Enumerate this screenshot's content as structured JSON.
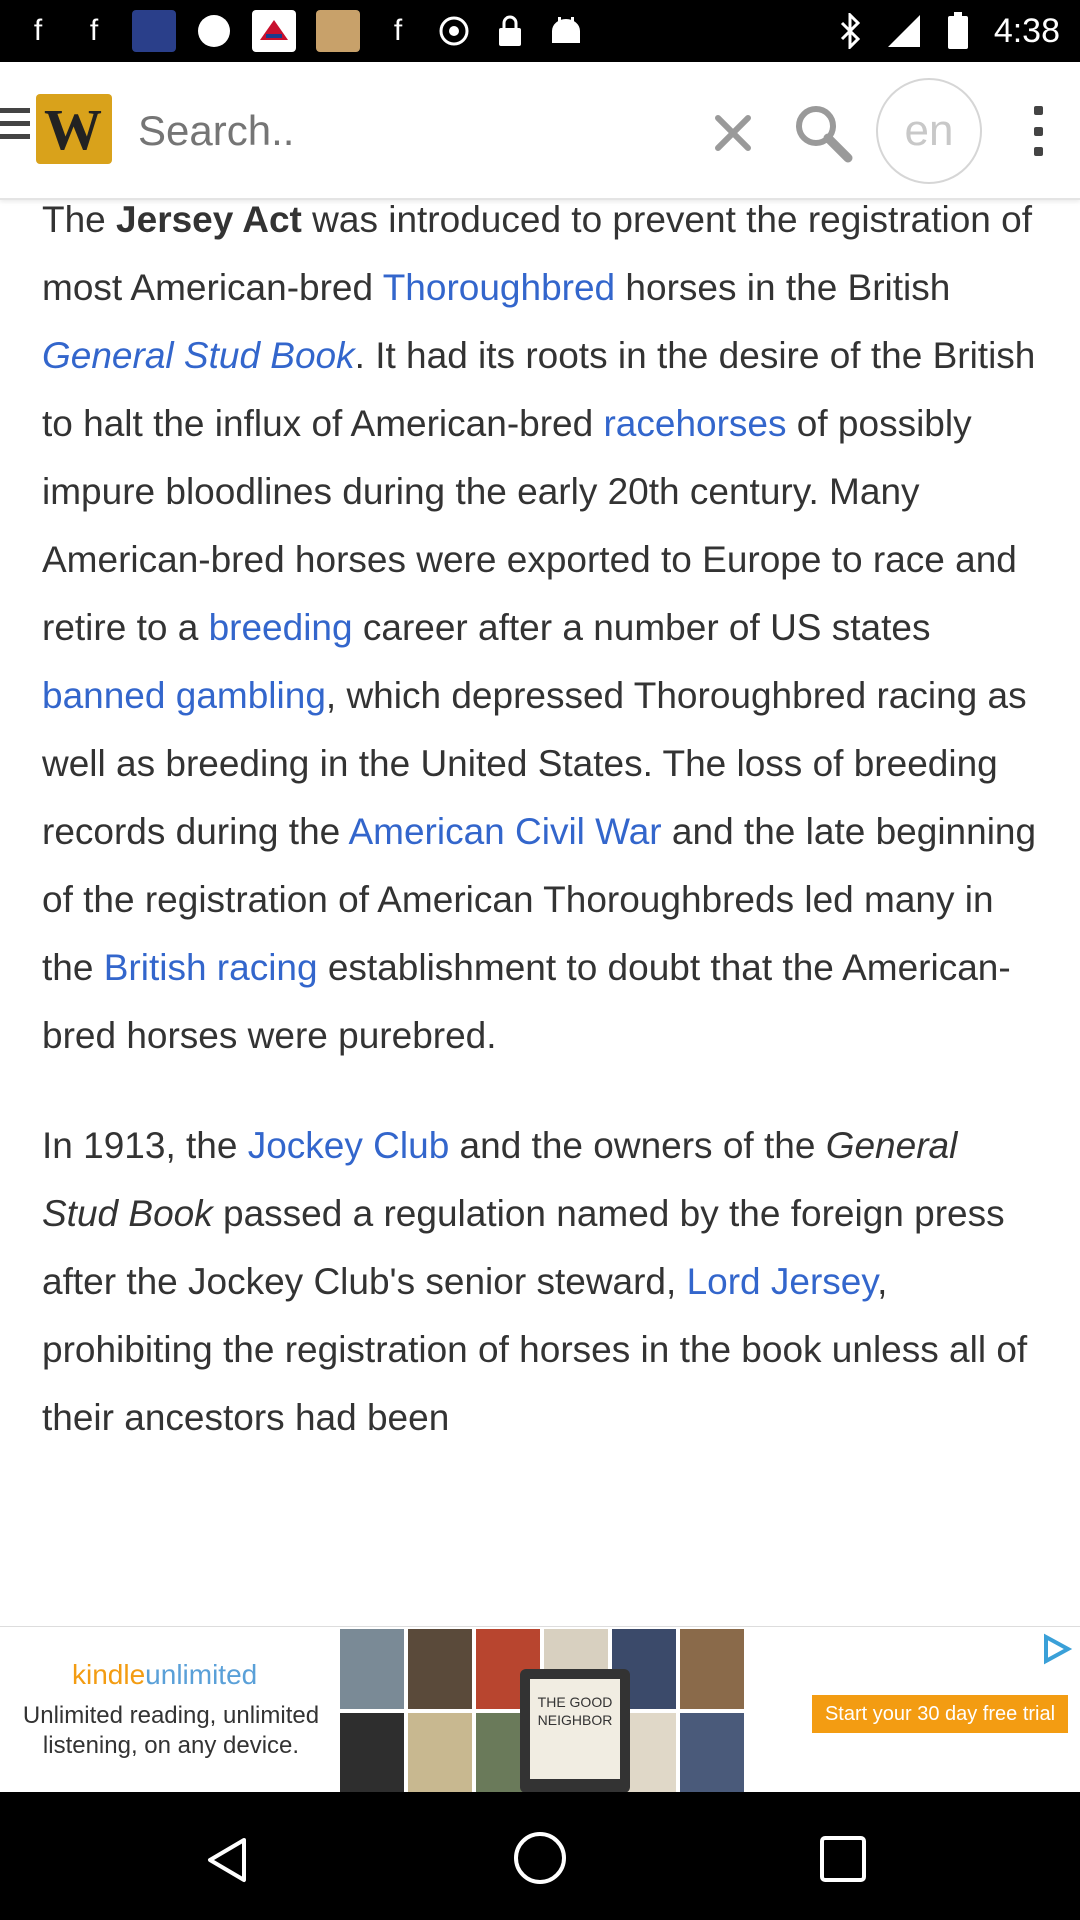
{
  "status_bar": {
    "time": "4:38",
    "icons": [
      "facebook-icon",
      "facebook-icon",
      "app-thumbnail",
      "circle-icon",
      "airline-icon",
      "app-thumbnail",
      "facebook-icon",
      "alarm-icon",
      "lock-icon",
      "android-icon",
      "bluetooth-icon",
      "signal-icon",
      "battery-icon"
    ]
  },
  "app_bar": {
    "logo_letter": "W",
    "search_placeholder": "Search..",
    "language": "en"
  },
  "article": {
    "p1": [
      {
        "t": "The "
      },
      {
        "t": "Jersey Act",
        "b": true
      },
      {
        "t": " was introduced to prevent the registration of most American-bred "
      },
      {
        "t": "Thoroughbred",
        "link": true
      },
      {
        "t": " horses in the British "
      },
      {
        "t": "General Stud Book",
        "link": true,
        "i": true
      },
      {
        "t": ". It had its roots in the desire of the British to halt the influx of American-bred "
      },
      {
        "t": "racehorses",
        "link": true
      },
      {
        "t": " of possibly impure bloodlines during the early 20th century. Many American-bred horses were exported to Europe to race and retire to a "
      },
      {
        "t": "breeding",
        "link": true
      },
      {
        "t": " career after a number of US states "
      },
      {
        "t": "banned gambling",
        "link": true
      },
      {
        "t": ", which depressed Thoroughbred racing as well as breeding in the United States. The loss of breeding records during the "
      },
      {
        "t": "American Civil War",
        "link": true
      },
      {
        "t": " and the late beginning of the registration of American Thoroughbreds led many in the "
      },
      {
        "t": "British racing",
        "link": true
      },
      {
        "t": " establishment to doubt that the American-bred horses were purebred."
      }
    ],
    "p2": [
      {
        "t": "In 1913, the "
      },
      {
        "t": "Jockey Club",
        "link": true
      },
      {
        "t": " and the owners of the "
      },
      {
        "t": "General Stud Book",
        "i": true
      },
      {
        "t": " passed a regulation named by the foreign press after the Jockey Club's senior steward, "
      },
      {
        "t": "Lord Jersey",
        "link": true
      },
      {
        "t": ", prohibiting the registration of horses in the book unless all of their ancestors had been"
      }
    ]
  },
  "ad": {
    "brand_a": "kindle",
    "brand_b": "unlimited",
    "tagline": "Unlimited reading, unlimited listening, on any device.",
    "device_text": "THE GOOD NEIGHBOR",
    "cta": "Start your 30 day free trial"
  },
  "colors": {
    "link": "#3366cc",
    "text": "#333333",
    "logo_bg": "#d9a21b",
    "ad_orange": "#f39c12"
  }
}
